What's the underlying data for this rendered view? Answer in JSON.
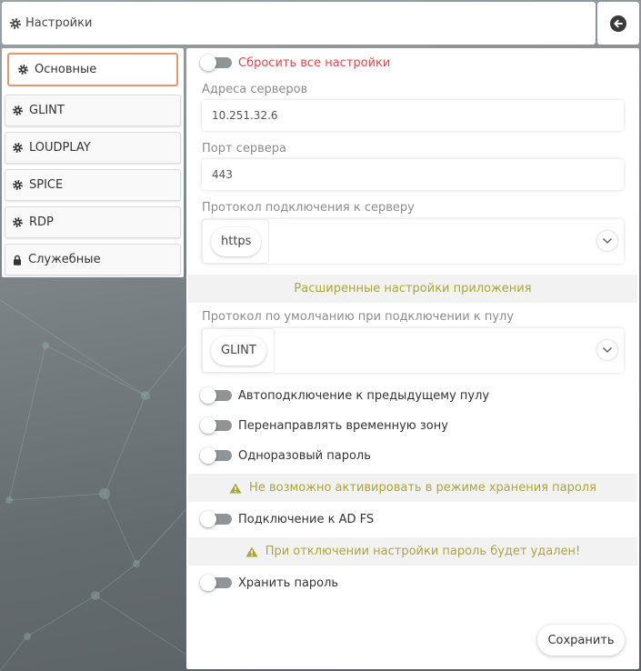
{
  "header": {
    "icon": "gear-icon",
    "title": "Настройки",
    "back_icon": "arrow-left-icon"
  },
  "sidebar": {
    "items": [
      {
        "label": "Основные",
        "icon": "gear-icon",
        "active": true
      },
      {
        "label": "GLINT",
        "icon": "gear-icon",
        "active": false
      },
      {
        "label": "LOUDPLAY",
        "icon": "gear-icon",
        "active": false
      },
      {
        "label": "SPICE",
        "icon": "gear-icon",
        "active": false
      },
      {
        "label": "RDP",
        "icon": "gear-icon",
        "active": false
      },
      {
        "label": "Служебные",
        "icon": "lock-icon",
        "active": false
      }
    ]
  },
  "main": {
    "reset_all": {
      "label": "Сбросить все настройки",
      "enabled": false
    },
    "server_addresses": {
      "label": "Адреса серверов",
      "value": "10.251.32.6"
    },
    "server_port": {
      "label": "Порт сервера",
      "value": "443"
    },
    "connection_protocol": {
      "label": "Протокол подключения к серверу",
      "value": "https",
      "chevron_icon": "chevron-down-icon"
    },
    "advanced_section": {
      "title": "Расширенные настройки приложения"
    },
    "pool_protocol": {
      "label": "Протокол по умолчанию при подключении к пулу",
      "value": "GLINT",
      "chevron_icon": "chevron-down-icon"
    },
    "auto_connect": {
      "label": "Автоподключение к предыдущему пулу",
      "enabled": false
    },
    "redirect_timezone": {
      "label": "Перенаправлять временную зону",
      "enabled": false
    },
    "one_time_password": {
      "label": "Одноразовый пароль",
      "enabled": false
    },
    "otp_warning": {
      "icon": "warning-icon",
      "text": "Не возможно активировать в режиме хранения пароля"
    },
    "ad_fs": {
      "label": "Подключение к AD FS",
      "enabled": false
    },
    "ad_fs_warning": {
      "icon": "warning-icon",
      "text": "При отключении настройки пароль будет удален!"
    },
    "store_password": {
      "label": "Хранить пароль",
      "enabled": false
    },
    "save_label": "Сохранить"
  },
  "colors": {
    "accent": "#e8956a",
    "danger": "#e04848",
    "warning": "#aaa63a",
    "toggle_off": "#8f9599"
  }
}
